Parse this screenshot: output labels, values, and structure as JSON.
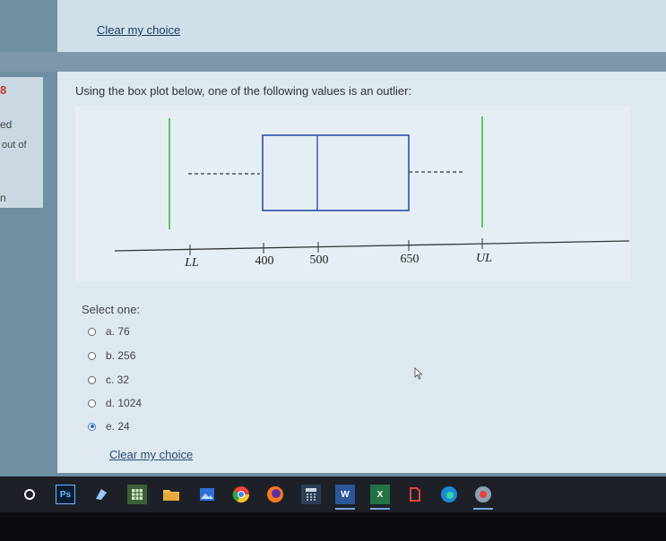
{
  "header": {
    "clear_link": "Clear my choice"
  },
  "info": {
    "question_number": "8",
    "line1": "ed",
    "line2": "out of",
    "line3": "n"
  },
  "question": {
    "text": "Using the box plot below, one of the following values is an outlier:",
    "axis_labels": [
      "LL",
      "400",
      "500",
      "650",
      "UL"
    ]
  },
  "answers": {
    "select_label": "Select one:",
    "options": [
      {
        "label": "a. 76",
        "selected": false
      },
      {
        "label": "b. 256",
        "selected": false
      },
      {
        "label": "c. 32",
        "selected": false
      },
      {
        "label": "d. 1024",
        "selected": false
      },
      {
        "label": "e. 24",
        "selected": true
      }
    ],
    "clear_link": "Clear my choice"
  },
  "colors": {
    "fence_line": "#5cc85c",
    "box_stroke": "#3f5fb0",
    "selected_radio": "#2a62c0"
  },
  "taskbar": {
    "icons": [
      "search-circle",
      "photoshop",
      "app-blue",
      "app-green-grid",
      "file-explorer",
      "photos",
      "chrome",
      "firefox",
      "calculator",
      "word",
      "excel",
      "app-red",
      "edge",
      "chrome-alt"
    ],
    "ps_label": "Ps",
    "word_label": "W",
    "excel_label": "X"
  }
}
